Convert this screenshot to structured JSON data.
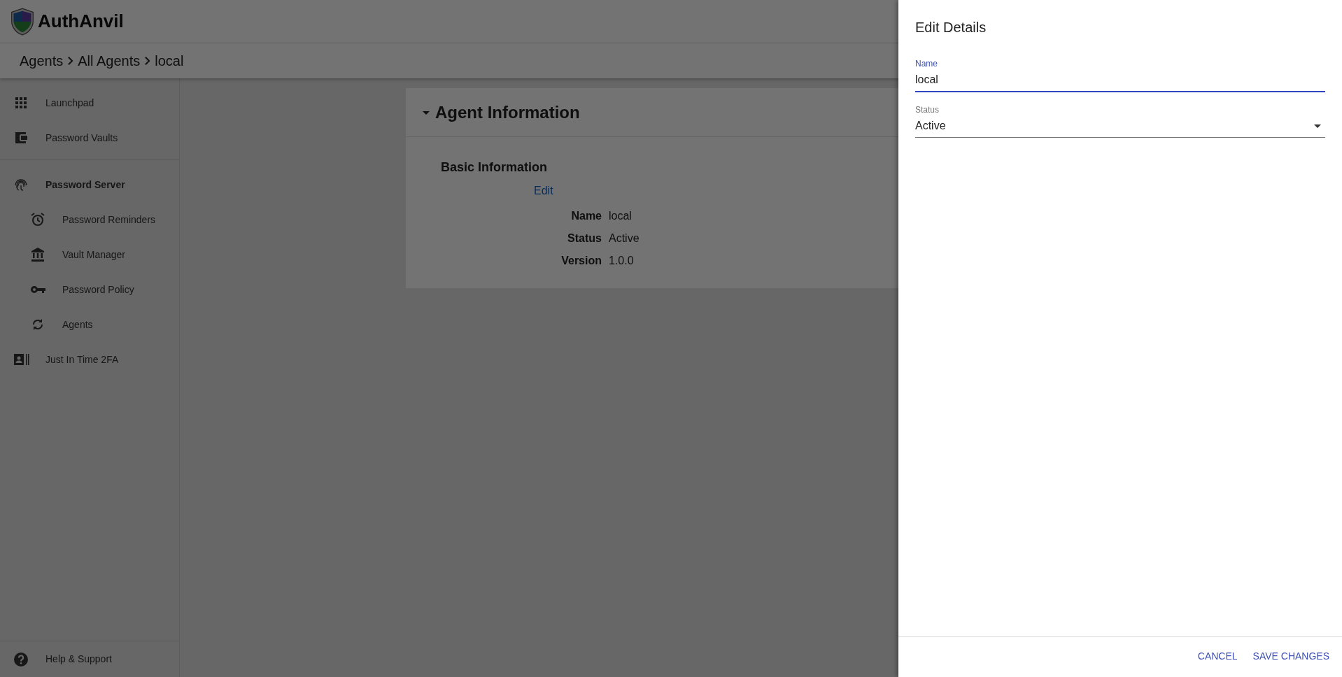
{
  "app": {
    "name": "AuthAnvil"
  },
  "breadcrumb": [
    "Agents",
    "All Agents",
    "local"
  ],
  "sidebar": {
    "sections": [
      [
        {
          "label": "Launchpad",
          "kind": "grid",
          "active": false
        },
        {
          "label": "Password Vaults",
          "kind": "wallet",
          "active": false
        }
      ],
      [
        {
          "label": "Password Server",
          "kind": "fingerprint",
          "active": true,
          "children": [
            {
              "label": "Password Reminders",
              "kind": "alarm",
              "active": false
            },
            {
              "label": "Vault Manager",
              "kind": "bank",
              "active": false
            },
            {
              "label": "Password Policy",
              "kind": "key",
              "active": false
            },
            {
              "label": "Agents",
              "kind": "sync",
              "active": false
            }
          ]
        },
        {
          "label": "Just In Time 2FA",
          "kind": "card",
          "active": false
        }
      ]
    ],
    "footer_item": {
      "label": "Help & Support",
      "kind": "help"
    }
  },
  "card": {
    "title": "Agent Information",
    "expanded": true,
    "section_title": "Basic Information",
    "edit_link": "Edit",
    "details": [
      {
        "label": "Name",
        "value": "local"
      },
      {
        "label": "Status",
        "value": "Active"
      },
      {
        "label": "Version",
        "value": "1.0.0"
      }
    ]
  },
  "drawer": {
    "title": "Edit Details",
    "fields": [
      {
        "kind": "text",
        "label": "Name",
        "value": "local",
        "focused": true
      },
      {
        "kind": "select",
        "label": "Status",
        "value": "Active",
        "focused": false
      }
    ],
    "buttons": [
      "CANCEL",
      "SAVE CHANGES"
    ]
  }
}
